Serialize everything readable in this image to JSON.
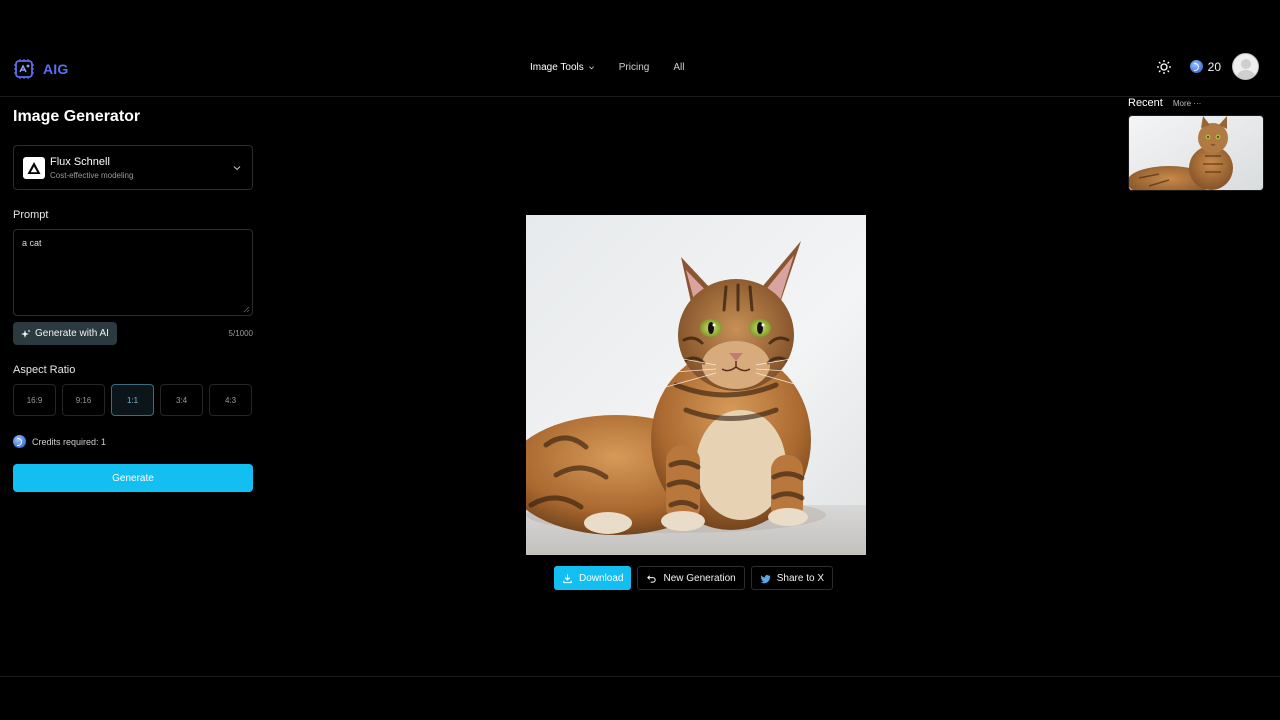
{
  "header": {
    "brand": "AIG",
    "nav": [
      {
        "label": "Image Tools"
      },
      {
        "label": "Pricing"
      },
      {
        "label": "All"
      }
    ],
    "credits": "20"
  },
  "panel": {
    "title": "Image Generator",
    "model": {
      "name": "Flux Schnell",
      "subtitle": "Cost-effective modeling"
    },
    "prompt_label": "Prompt",
    "prompt_value": "a cat",
    "generate_ai_label": "Generate with AI",
    "char_count": "5/1000",
    "aspect_label": "Aspect Ratio",
    "ratios": [
      "16:9",
      "9:16",
      "1:1",
      "3:4",
      "4:3"
    ],
    "selected_ratio": "1:1",
    "credits_required": "Credits required: 1",
    "generate_label": "Generate"
  },
  "recent": {
    "title": "Recent",
    "more": "More ···"
  },
  "result": {
    "download_label": "Download",
    "new_generation_label": "New Generation",
    "share_label": "Share to X"
  },
  "colors": {
    "accent": "#12bff0",
    "brand": "#5b6ef0",
    "background": "#000000"
  },
  "icons": [
    "brand-logo-icon",
    "chevron-down-icon",
    "sun-icon",
    "coin-icon",
    "avatar-icon",
    "sparkle-icon",
    "download-icon",
    "undo-icon",
    "twitter-icon",
    "model-logo-icon"
  ]
}
